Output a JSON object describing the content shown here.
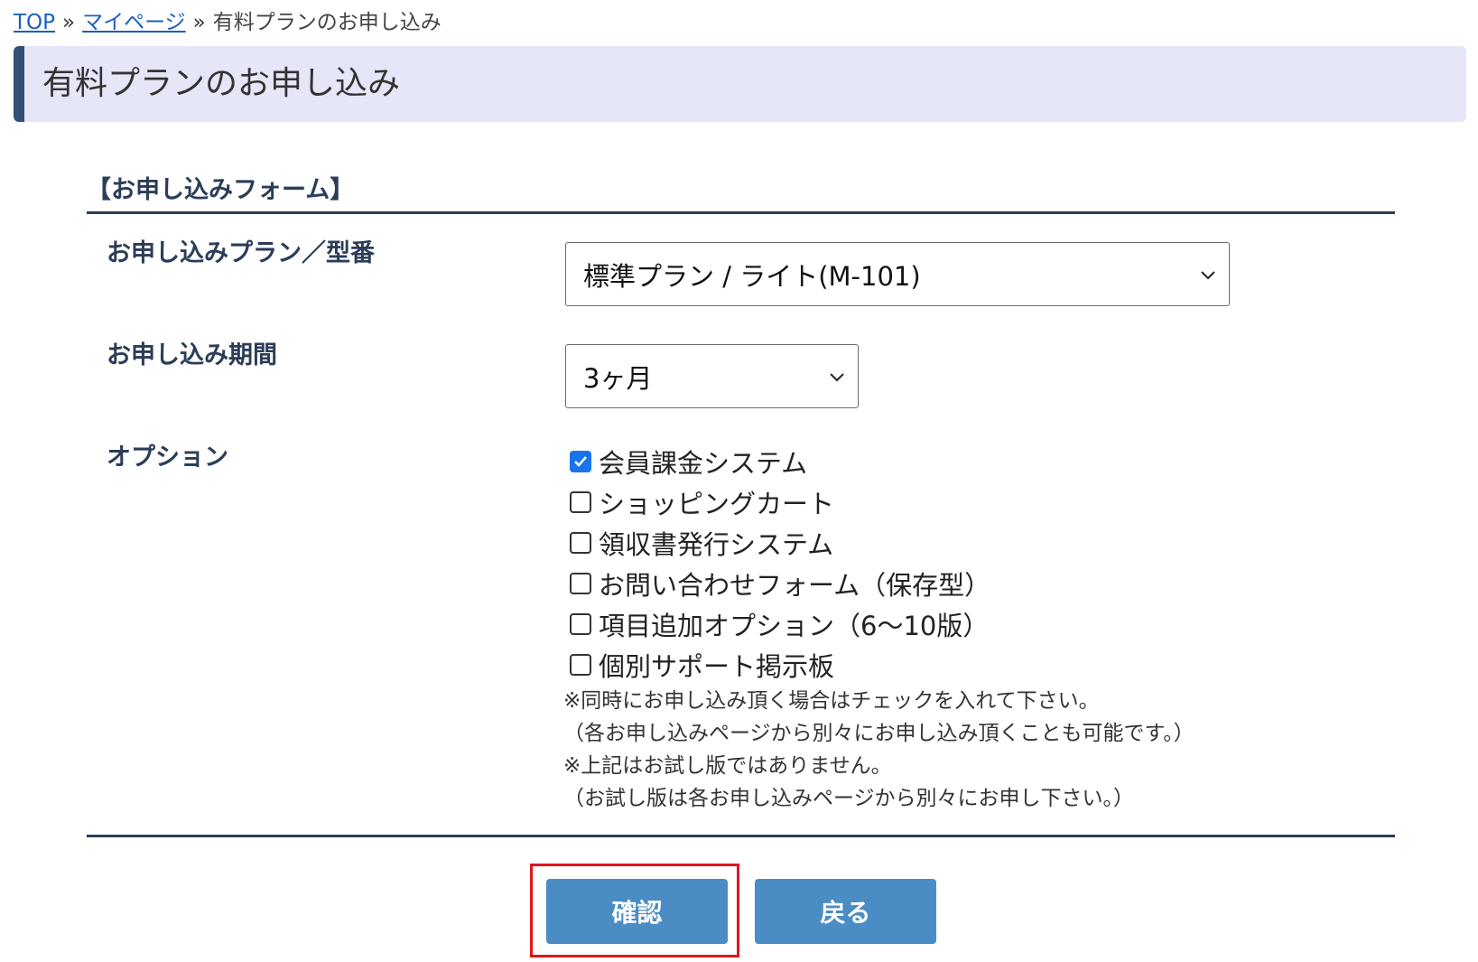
{
  "breadcrumb": {
    "top": "TOP",
    "mypage": "マイページ",
    "separator": "»",
    "current": "有料プランのお申し込み"
  },
  "page_title": "有料プランのお申し込み",
  "form": {
    "section_title": "【お申し込みフォーム】",
    "plan": {
      "label": "お申し込みプラン／型番",
      "selected": "標準プラン / ライト(M-101)"
    },
    "period": {
      "label": "お申し込み期間",
      "selected": "3ヶ月"
    },
    "options": {
      "label": "オプション",
      "items": [
        {
          "label": "会員課金システム",
          "checked": true
        },
        {
          "label": "ショッピングカート",
          "checked": false
        },
        {
          "label": "領収書発行システム",
          "checked": false
        },
        {
          "label": "お問い合わせフォーム（保存型）",
          "checked": false
        },
        {
          "label": "項目追加オプション（6～10版）",
          "checked": false
        },
        {
          "label": "個別サポート掲示板",
          "checked": false
        }
      ],
      "notes": [
        "※同時にお申し込み頂く場合はチェックを入れて下さい。",
        "（各お申し込みページから別々にお申し込み頂くことも可能です。）",
        "※上記はお試し版ではありません。",
        "（お試し版は各お申し込みページから別々にお申し下さい。）"
      ]
    }
  },
  "buttons": {
    "confirm": "確認",
    "back": "戻る"
  },
  "colors": {
    "header_bg": "#e5e6f7",
    "header_accent": "#334f75",
    "label_color": "#2b3d57",
    "button_bg": "#4a8cc4",
    "highlight": "#e0141e",
    "link": "#1a5fc2"
  }
}
